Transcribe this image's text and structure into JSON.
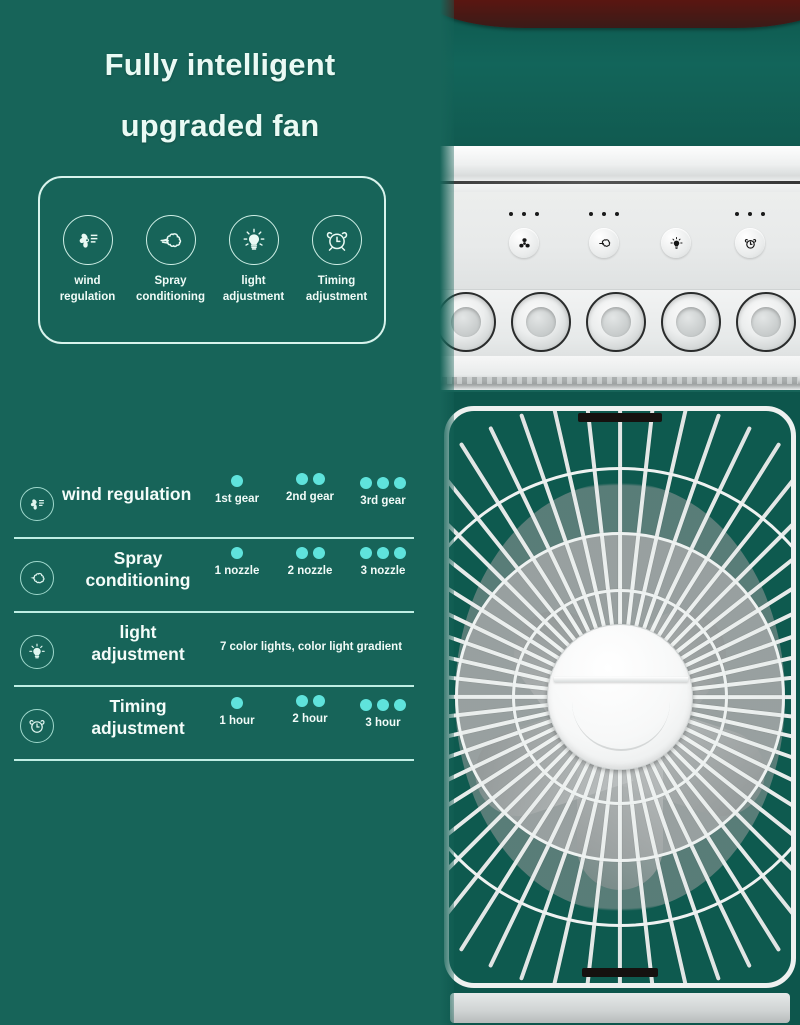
{
  "heading": {
    "line1": "Fully intelligent",
    "line2": "upgraded fan"
  },
  "colors": {
    "background_green": "#176459",
    "accent_cyan": "#5FE3DC",
    "text_white": "#F2FBF8",
    "divider": "#BFEEE4",
    "product_red_arc": "#5E1510"
  },
  "feature_card": {
    "items": [
      {
        "icon": "fan-icon",
        "label_line1": "wind",
        "label_line2": "regulation"
      },
      {
        "icon": "spray-icon",
        "label_line1": "Spray",
        "label_line2": "conditioning"
      },
      {
        "icon": "bulb-icon",
        "label_line1": "light",
        "label_line2": "adjustment"
      },
      {
        "icon": "timer-icon",
        "label_line1": "Timing",
        "label_line2": "adjustment"
      }
    ]
  },
  "specs": {
    "rows": [
      {
        "icon": "fan-icon",
        "name_line1": "wind regulation",
        "name_line2": "",
        "levels": [
          {
            "dots": 1,
            "label": "1st gear"
          },
          {
            "dots": 2,
            "label": "2nd gear"
          },
          {
            "dots": 3,
            "label": "3rd gear"
          }
        ]
      },
      {
        "icon": "spray-icon",
        "name_line1": "Spray",
        "name_line2": "conditioning",
        "levels": [
          {
            "dots": 1,
            "label": "1 nozzle"
          },
          {
            "dots": 2,
            "label": "2 nozzle"
          },
          {
            "dots": 3,
            "label": "3 nozzle"
          }
        ]
      },
      {
        "icon": "bulb-icon",
        "name_line1": "light",
        "name_line2": "adjustment",
        "note": "7 color lights, color light gradient",
        "levels": []
      },
      {
        "icon": "timer-icon",
        "name_line1": "Timing",
        "name_line2": "adjustment",
        "levels": [
          {
            "dots": 1,
            "label": "1 hour"
          },
          {
            "dots": 2,
            "label": "2 hour"
          },
          {
            "dots": 3,
            "label": "3 hour"
          }
        ]
      }
    ]
  },
  "product_photo": {
    "control_panel": {
      "buttons": [
        {
          "icon": "fan-icon",
          "indicator_dots": 3
        },
        {
          "icon": "spray-icon",
          "indicator_dots": 3
        },
        {
          "icon": "bulb-icon",
          "indicator_dots": 0
        },
        {
          "icon": "timer-icon",
          "indicator_dots": 3
        }
      ]
    },
    "vent_knob_count": 5,
    "fan_grille": {
      "spoke_count": 56,
      "hub": "center-cap"
    }
  }
}
